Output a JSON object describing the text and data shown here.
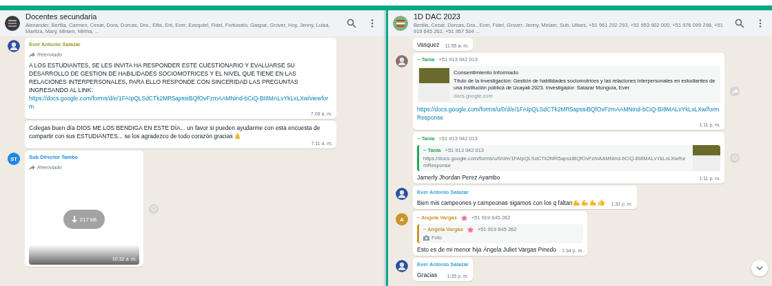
{
  "panes": [
    {
      "title": "Docentes secundaria",
      "members": "Alexander, Bertila, Carmen, Cesar, Dora, Dorcas, Dra., Ellis, Eni, Ever, Ezequiel, Fidel, Fortunato, Gaspar, Grover, Hoy, Jenny, Luisa, Maritza, Mary, Miriam, Mirtha, ...",
      "messages": [
        {
          "avatar": {
            "kind": "photo",
            "color": "#2d4fa0"
          },
          "sender": {
            "name": "Ever Antonio Salazar",
            "color": "#9a9a2b"
          },
          "forwarded": "Reenviado",
          "body": "A LOS ESTUDIANTES, SE LES INVITA HA RESPONDER ESTE CUESTIONARIO Y EVALUARSE SU DESARROLLO DE GESTION DE HABILIDADES SOCIOMOTRICES Y EL NIVEL QUE TIENE EN LAS RELACIONES INTERPERSONALES, PARA ELLO RESPONDE CON SINCERIDAD LAS PREGUNTAS INGRESANDO AL LINK:",
          "link": "https://docs.google.com/forms/d/e/1FAIpQLSdCTk2MR5apssiBQfOvFzmAAMNind-bCiQ-BI8MALvYkLxLXw/viewform",
          "time": "7:09 a. m."
        },
        {
          "body": "Colegas buen día DIOS ME LOS BENDIGA EN ESTE DÍA... un favor si pueden ayudarme con esta encuesta de compartir con sus ESTUDIANTES... se los agradezco de todo corazón gracias",
          "emojis": [
            {
              "kind": "pray"
            }
          ],
          "time": "7:11 a. m."
        },
        {
          "avatar": {
            "kind": "initials",
            "initials": "ST",
            "color": "#1e88e5"
          },
          "sender": {
            "name": "Sub Director Tambo",
            "color": "#1e88e5"
          },
          "forwarded": "Reenviado",
          "media": {
            "size": "217 kB"
          },
          "time": "10:32 a. m.",
          "side_button": {
            "kind": "react"
          }
        }
      ]
    },
    {
      "title": "1D DAC 2023",
      "members": "Bertila, Cesar, Dorcas, Dra., Ever, Fidel, Grover, Jenny, Miriam, Sub, Ulises, +51 961 292 293, +51 953 902 000, +51 976 099 298, +51 919 645 262, +51 957 504 ...",
      "messages": [
        {
          "body": "Vasquez",
          "time": "11:55 a. m."
        },
        {
          "avatar": {
            "kind": "photo",
            "color": "#8a6f6f"
          },
          "sender": {
            "name": "~ Tania",
            "phone": "+51 913 942 013",
            "color": "#1fa855"
          },
          "preview": {
            "title": "Consentimiento Informado",
            "description": "Título de la investigación: Gestión de habilidades sociomotrices y las relaciones interpersonales en estudiantes de una institución pública de Ucayali 2023. Investigador: Salazar Munguía, Ever",
            "domain": "docs.google.com"
          },
          "link": "https://docs.google.com/forms/u/0/d/e/1FAIpQLSdCTk2MR5apssiBQfOvFzmAAMNind-bCiQ-BI8MALvYkLxLXw/formResponse",
          "time": "1:11 p. m.",
          "side_button": {
            "kind": "forward"
          }
        },
        {
          "sender": {
            "name": "~ Tania",
            "phone": "+51 913 942 013",
            "color": "#1fa855"
          },
          "quote": {
            "name": "~ Tania",
            "phone": "+51 913 942 013",
            "color": "#1fa855",
            "text": "https://docs.google.com/forms/u/0/d/e/1FAIpQLSdCTk2MR5apssiBQfOvFzmAAMNind-bCiQ-BI8MALvYkLxLXw/formResponse",
            "thumbnail": true
          },
          "body": "Jamerly Jhordan Perez Ayambo",
          "time": "1:11 p. m.",
          "side_button": {
            "kind": "react"
          }
        },
        {
          "avatar": {
            "kind": "photo",
            "color": "#2d4fa0"
          },
          "sender": {
            "name": "Ever Antonio Salazar",
            "color": "#35a4d8"
          },
          "body": "Bien mis campeones y campeonas sigamos con los q faltan",
          "emojis": [
            {
              "kind": "biceps"
            },
            {
              "kind": "biceps"
            },
            {
              "kind": "biceps"
            },
            {
              "kind": "thumbs-up"
            }
          ],
          "time": "1:33 p. m."
        },
        {
          "avatar": {
            "kind": "initials",
            "initials": "A",
            "color": "#c9962b"
          },
          "sender": {
            "name": "~ Angela Vargas",
            "phone": "+51 919 645 262",
            "color": "#c9962b",
            "flower": true
          },
          "quote": {
            "name": "~ Angela Vargas",
            "phone": "+51 919 645 262",
            "color": "#c9962b",
            "flower": true,
            "photo_label": "Foto"
          },
          "body": "Esto es de mi menor  hija Ángela Juliet Vargas Pinedo",
          "time": "1:34 p. m."
        },
        {
          "avatar": {
            "kind": "photo",
            "color": "#2d4fa0"
          },
          "sender": {
            "name": "Ever Antonio Salazar",
            "color": "#35a4d8"
          },
          "body": "Gracias",
          "time": "1:35 p. m."
        }
      ]
    }
  ]
}
